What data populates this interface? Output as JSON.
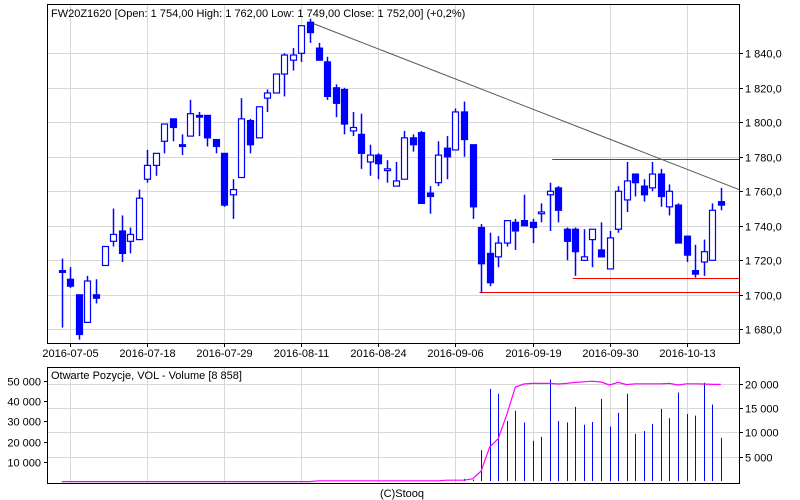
{
  "chart_data": [
    {
      "type": "candlestick",
      "title": "FW20Z1620 [Open: 1 754,00  High: 1 762,00  Low: 1 749,00  Close: 1 752,00] (+0,2%)",
      "ylim": [
        1670,
        1865
      ],
      "y_ticks": [
        1680,
        1700,
        1720,
        1740,
        1760,
        1780,
        1800,
        1820,
        1840
      ],
      "y_tick_labels": [
        "1 680,0",
        "1 700,0",
        "1 720,0",
        "1 740,0",
        "1 760,0",
        "1 780,0",
        "1 800,0",
        "1 820,0",
        "1 840,0"
      ],
      "x_tick_indices": [
        1,
        10,
        19,
        28,
        37,
        46,
        55,
        64,
        73
      ],
      "x_tick_labels": [
        "2016-07-05",
        "2016-07-18",
        "2016-07-29",
        "2016-08-11",
        "2016-08-24",
        "2016-09-06",
        "2016-09-19",
        "2016-09-30",
        "2016-10-13"
      ],
      "grid": true,
      "colors": {
        "candle": "#0000ff",
        "trendline": "#555555",
        "level": "#ff0000",
        "grid": "#d8d8d8"
      },
      "ohlc": [
        [
          1714,
          1721,
          1681,
          1713
        ],
        [
          1709,
          1716,
          1704,
          1705
        ],
        [
          1700,
          1700,
          1674,
          1677
        ],
        [
          1684,
          1711,
          1684,
          1708
        ],
        [
          1700,
          1709,
          1695,
          1698
        ],
        [
          1717,
          1728,
          1717,
          1728
        ],
        [
          1731,
          1750,
          1728,
          1735
        ],
        [
          1737,
          1746,
          1719,
          1724
        ],
        [
          1731,
          1739,
          1724,
          1735
        ],
        [
          1732,
          1761,
          1732,
          1756
        ],
        [
          1767,
          1784,
          1765,
          1775
        ],
        [
          1775,
          1782,
          1769,
          1782
        ],
        [
          1789,
          1799,
          1782,
          1799
        ],
        [
          1802,
          1802,
          1789,
          1797
        ],
        [
          1787,
          1793,
          1781,
          1786
        ],
        [
          1792,
          1813,
          1792,
          1805
        ],
        [
          1804,
          1806,
          1792,
          1803
        ],
        [
          1804,
          1804,
          1786,
          1791
        ],
        [
          1790,
          1790,
          1782,
          1786
        ],
        [
          1782,
          1782,
          1751,
          1752
        ],
        [
          1758,
          1767,
          1744,
          1761
        ],
        [
          1768,
          1814,
          1768,
          1802
        ],
        [
          1801,
          1802,
          1782,
          1787
        ],
        [
          1791,
          1809,
          1791,
          1809
        ],
        [
          1814,
          1819,
          1806,
          1817
        ],
        [
          1817,
          1828,
          1817,
          1828
        ],
        [
          1828,
          1840,
          1815,
          1839
        ],
        [
          1836,
          1843,
          1830,
          1839
        ],
        [
          1840,
          1856,
          1835,
          1856
        ],
        [
          1858,
          1860,
          1846,
          1852
        ],
        [
          1843,
          1846,
          1836,
          1836
        ],
        [
          1835,
          1838,
          1813,
          1815
        ],
        [
          1820,
          1822,
          1803,
          1811
        ],
        [
          1819,
          1820,
          1793,
          1799
        ],
        [
          1795,
          1806,
          1792,
          1797
        ],
        [
          1793,
          1805,
          1773,
          1782
        ],
        [
          1777,
          1787,
          1769,
          1781
        ],
        [
          1781,
          1782,
          1767,
          1776
        ],
        [
          1772,
          1778,
          1765,
          1773
        ],
        [
          1763,
          1777,
          1763,
          1766
        ],
        [
          1767,
          1795,
          1767,
          1791
        ],
        [
          1791,
          1793,
          1783,
          1787
        ],
        [
          1794,
          1795,
          1753,
          1753
        ],
        [
          1759,
          1763,
          1747,
          1757
        ],
        [
          1765,
          1789,
          1763,
          1781
        ],
        [
          1785,
          1792,
          1767,
          1780
        ],
        [
          1784,
          1808,
          1784,
          1806
        ],
        [
          1806,
          1812,
          1780,
          1790
        ],
        [
          1787,
          1787,
          1744,
          1751
        ],
        [
          1739,
          1741,
          1701,
          1718
        ],
        [
          1724,
          1736,
          1705,
          1707
        ],
        [
          1722,
          1734,
          1716,
          1730
        ],
        [
          1730,
          1743,
          1728,
          1743
        ],
        [
          1742,
          1744,
          1726,
          1737
        ],
        [
          1743,
          1758,
          1740,
          1740
        ],
        [
          1742,
          1744,
          1730,
          1739
        ],
        [
          1747,
          1753,
          1742,
          1748
        ],
        [
          1758,
          1765,
          1737,
          1760
        ],
        [
          1762,
          1763,
          1742,
          1749
        ],
        [
          1738,
          1739,
          1720,
          1731
        ],
        [
          1738,
          1739,
          1711,
          1725
        ],
        [
          1720,
          1738,
          1720,
          1722
        ],
        [
          1732,
          1738,
          1716,
          1738
        ],
        [
          1726,
          1742,
          1722,
          1722
        ],
        [
          1715,
          1737,
          1715,
          1733
        ],
        [
          1738,
          1763,
          1736,
          1760
        ],
        [
          1755,
          1777,
          1748,
          1766
        ],
        [
          1770,
          1770,
          1757,
          1765
        ],
        [
          1763,
          1767,
          1754,
          1758
        ],
        [
          1762,
          1777,
          1760,
          1770
        ],
        [
          1770,
          1773,
          1751,
          1757
        ],
        [
          1751,
          1764,
          1746,
          1760
        ],
        [
          1752,
          1753,
          1730,
          1730
        ],
        [
          1734,
          1734,
          1719,
          1723
        ],
        [
          1714,
          1729,
          1710,
          1712
        ],
        [
          1719,
          1732,
          1711,
          1725
        ],
        [
          1720,
          1753,
          1720,
          1749
        ],
        [
          1754,
          1762,
          1749,
          1752
        ]
      ],
      "trendline": {
        "start": {
          "index": 29,
          "price": 1858
        },
        "end": {
          "index": 79.2,
          "price": 1761
        }
      },
      "levels": [
        {
          "price": 1778.5,
          "from_index": 57.3
        },
        {
          "price": 1710,
          "from_index": 59.7
        },
        {
          "price": 1701.5,
          "from_index": 48.8
        }
      ]
    },
    {
      "type": "bar+line",
      "title": "Otwarte Pozycje, VOL - Volume [8 858]",
      "left_ylim": [
        0,
        50000
      ],
      "left_ticks": [
        10000,
        20000,
        30000,
        40000,
        50000
      ],
      "left_tick_labels": [
        "10 000",
        "20 000",
        "30 000",
        "40 000",
        "50 000"
      ],
      "right_ylim": [
        0,
        20000
      ],
      "right_ticks": [
        5000,
        10000,
        15000,
        20000
      ],
      "right_tick_labels": [
        "5 000",
        "10 000",
        "15 000",
        "20 000"
      ],
      "colors": {
        "volume": "#0000ff",
        "open_interest": "#ff00ff"
      },
      "volume_start_index": 47,
      "volume": [
        440,
        275,
        6330,
        18900,
        17900,
        12300,
        14400,
        12000,
        8250,
        9080,
        20800,
        12300,
        12000,
        15200,
        11550,
        12100,
        16850,
        11150,
        14000,
        17900,
        9700,
        10250,
        11700,
        14800,
        12900,
        18150,
        13750,
        13400,
        20150,
        15700,
        8858
      ],
      "open_interest": [
        200,
        200,
        200,
        200,
        200,
        200,
        200,
        200,
        200,
        200,
        200,
        200,
        200,
        200,
        200,
        200,
        200,
        200,
        200,
        200,
        200,
        200,
        200,
        200,
        200,
        200,
        200,
        200,
        200,
        200,
        600,
        600,
        600,
        600,
        600,
        600,
        600,
        600,
        600,
        600,
        600,
        600,
        600,
        600,
        600,
        900,
        900,
        900,
        1600,
        5400,
        17300,
        21500,
        33400,
        47000,
        48500,
        48800,
        48800,
        48800,
        48500,
        48800,
        49300,
        49600,
        49900,
        49500,
        48000,
        49300,
        48200,
        48600,
        48600,
        48600,
        48600,
        48800,
        48000,
        48600,
        48600,
        48500,
        48300,
        48300
      ]
    }
  ],
  "footer": "(C)Stooq"
}
